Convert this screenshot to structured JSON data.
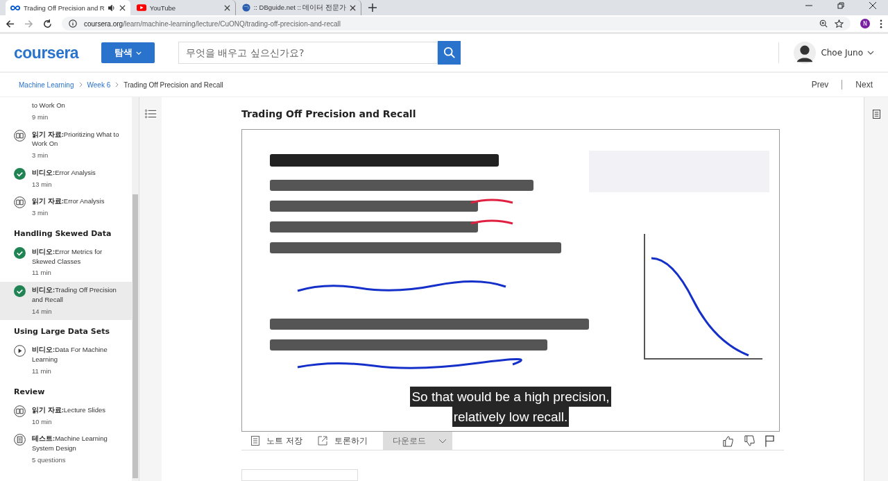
{
  "browser": {
    "tabs": [
      {
        "kind": "coursera",
        "title": "Trading Off Precision and R",
        "selected": true,
        "audio": true
      },
      {
        "kind": "youtube",
        "title": "YouTube",
        "selected": false,
        "audio": false
      },
      {
        "kind": "globe",
        "title": ":: DBguide.net :: 데이터 전문가",
        "selected": false,
        "audio": false
      }
    ],
    "url_host": "coursera.org",
    "url_path": "/learn/machine-learning/lecture/CuONQ/trading-off-precision-and-recall",
    "profile_initial": "N"
  },
  "header": {
    "logo": "coursera",
    "explore_button": "탐색",
    "search": {
      "placeholder": "무엇을 배우고 싶으신가요?"
    },
    "user_name": "Choe Juno"
  },
  "breadcrumb": {
    "items": [
      "Machine Learning",
      "Week 6",
      "Trading Off Precision and Recall"
    ],
    "prev": "Prev",
    "next": "Next"
  },
  "sidebar": {
    "entries": [
      {
        "kind": "partial",
        "title": "to Work On",
        "meta": "9 min",
        "selected": false
      },
      {
        "kind": "reading",
        "prefix": "읽기 자료:",
        "title": "Prioritizing What to Work On",
        "meta": "3 min",
        "selected": false
      },
      {
        "kind": "video_done",
        "prefix": "비디오:",
        "title": "Error Analysis",
        "meta": "13 min",
        "selected": false
      },
      {
        "kind": "reading",
        "prefix": "읽기 자료:",
        "title": "Error Analysis",
        "meta": "3 min",
        "selected": false
      },
      {
        "kind": "heading",
        "title": "Handling Skewed Data"
      },
      {
        "kind": "video_done",
        "prefix": "비디오:",
        "title": "Error Metrics for Skewed Classes",
        "meta": "11 min",
        "selected": false
      },
      {
        "kind": "video_done",
        "prefix": "비디오:",
        "title": "Trading Off Precision and Recall",
        "meta": "14 min",
        "selected": true
      },
      {
        "kind": "heading",
        "title": "Using Large Data Sets"
      },
      {
        "kind": "video",
        "prefix": "비디오:",
        "title": "Data For Machine Learning",
        "meta": "11 min",
        "selected": false
      },
      {
        "kind": "heading",
        "title": "Review"
      },
      {
        "kind": "reading",
        "prefix": "읽기 자료:",
        "title": "Lecture Slides",
        "meta": "10 min",
        "selected": false
      },
      {
        "kind": "quiz",
        "prefix": "테스트:",
        "title": "Machine Learning System Design",
        "meta": "5 questions",
        "selected": false
      }
    ]
  },
  "lecture": {
    "title": "Trading Off Precision and Recall",
    "video": {
      "kind": "picture",
      "captions": [
        "So that would be a high precision,",
        "relatively low recall."
      ]
    },
    "toolbar": {
      "save_note": "노트 저장",
      "discuss": "토론하기",
      "download": "다운로드"
    }
  }
}
